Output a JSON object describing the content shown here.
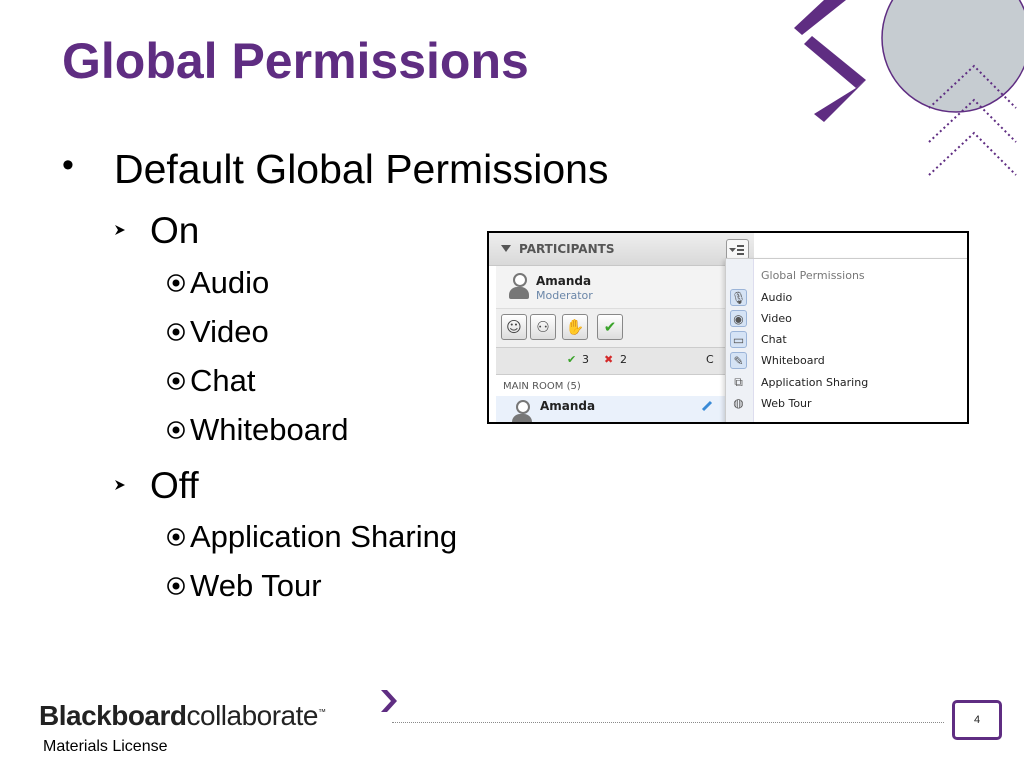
{
  "colors": {
    "brand_purple": "#5f2d82",
    "deco_gray": "#c6ccd1",
    "check_green": "#3aa32a",
    "x_red": "#d42a2a"
  },
  "slide": {
    "title": "Global Permissions",
    "bullet_char": "•",
    "main_bullet": "Default Global Permissions",
    "sections": [
      {
        "label": "On",
        "items": [
          "Audio",
          "Video",
          "Chat",
          "Whiteboard"
        ]
      },
      {
        "label": "Off",
        "items": [
          "Application Sharing",
          "Web Tour"
        ]
      }
    ]
  },
  "screenshot": {
    "header_label": "PARTICIPANTS",
    "user": {
      "name": "Amanda",
      "role": "Moderator"
    },
    "toolbar_icons": [
      "smiley-icon",
      "profile-icon",
      "hand-raise-icon",
      "checkmark-icon"
    ],
    "counts": {
      "yes": "3",
      "no": "2",
      "partial": "C"
    },
    "room": {
      "label": "MAIN ROOM (5)",
      "member": "Amanda"
    },
    "menu": {
      "title": "Global Permissions",
      "items": [
        {
          "label": "Audio",
          "icon": "microphone-icon",
          "enabled": true
        },
        {
          "label": "Video",
          "icon": "webcam-icon",
          "enabled": true
        },
        {
          "label": "Chat",
          "icon": "chat-bubble-icon",
          "enabled": true
        },
        {
          "label": "Whiteboard",
          "icon": "pencil-icon",
          "enabled": true
        },
        {
          "label": "Application Sharing",
          "icon": "app-share-icon",
          "enabled": false
        },
        {
          "label": "Web Tour",
          "icon": "globe-icon",
          "enabled": false
        }
      ]
    }
  },
  "footer": {
    "logo_bold": "Blackboard",
    "logo_light": "collaborate",
    "logo_tm": "™",
    "page_number": "4",
    "license": "Materials License"
  }
}
